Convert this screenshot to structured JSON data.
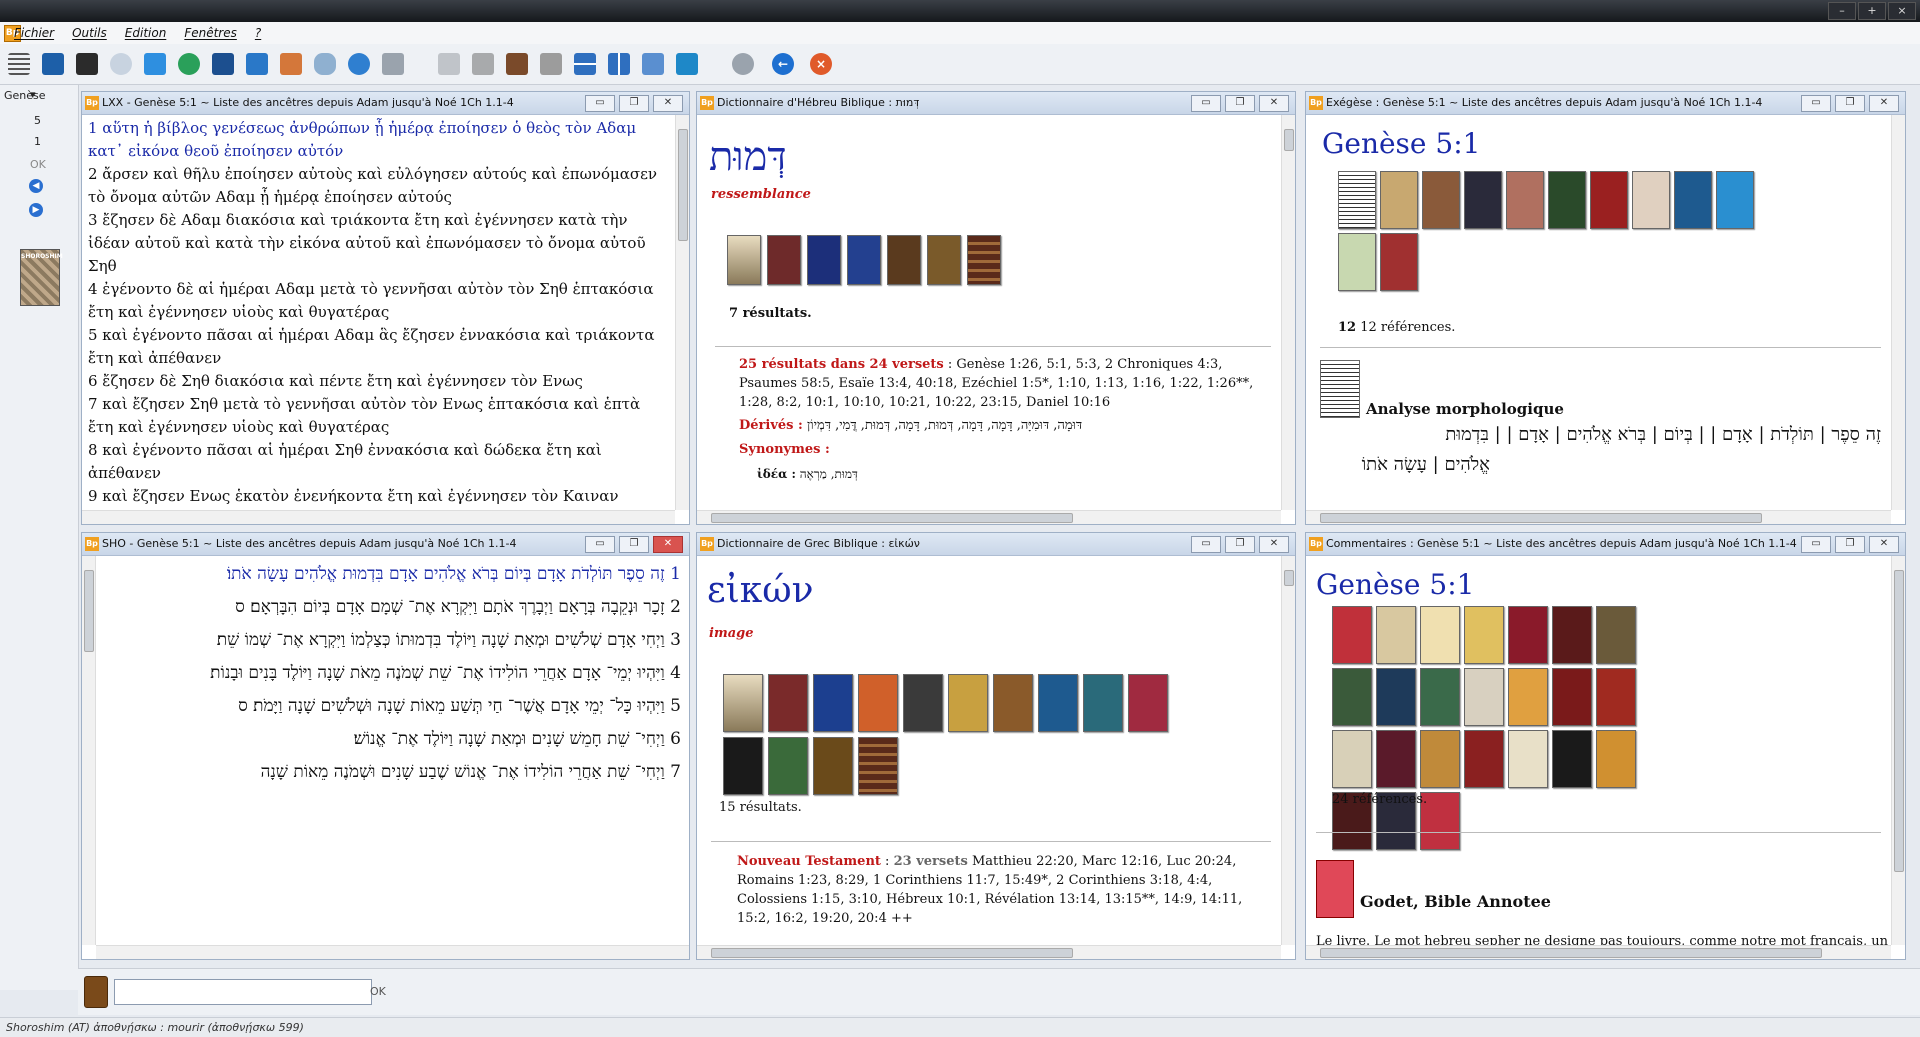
{
  "menu": {
    "fichier": "Fichier",
    "outils": "Outils",
    "edition": "Edition",
    "fenetres": "Fenêtres",
    "help": "?"
  },
  "left": {
    "book": "Genèse",
    "chapter": "5",
    "verse": "1",
    "ok": "OK",
    "module_label": "SHOROSHIM"
  },
  "lxx": {
    "title": "LXX - Genèse 5:1 ~ Liste des ancêtres depuis Adam jusqu'à Noé 1Ch 1.1-4",
    "verses": [
      "1 αὕτη ἡ βίβλος γενέσεως ἀνθρώπων ᾗ ἡμέρᾳ ἐποίησεν ὁ θεὸς τὸν Αδαμ κατ᾽ εἰκόνα θεοῦ ἐποίησεν αὐτόν",
      "2 ἄρσεν καὶ θῆλυ ἐποίησεν αὐτοὺς καὶ εὐλόγησεν αὐτούς καὶ ἐπωνόμασεν τὸ ὄνομα αὐτῶν Αδαμ ᾗ ἡμέρᾳ ἐποίησεν αὐτούς",
      "3 ἔζησεν δὲ Αδαμ διακόσια καὶ τριάκοντα ἔτη καὶ ἐγέννησεν κατὰ τὴν ἰδέαν αὐτοῦ καὶ κατὰ τὴν εἰκόνα αὐτοῦ καὶ ἐπωνόμασεν τὸ ὄνομα αὐτοῦ Σηθ",
      "4 ἐγένοντο δὲ αἱ ἡμέραι Αδαμ μετὰ τὸ γεννῆσαι αὐτὸν τὸν Σηθ ἑπτακόσια ἔτη καὶ ἐγέννησεν υἱοὺς καὶ θυγατέρας",
      "5 καὶ ἐγένοντο πᾶσαι αἱ ἡμέραι Αδαμ ἃς ἔζησεν ἐννακόσια καὶ τριάκοντα ἔτη καὶ ἀπέθανεν",
      "6 ἔζησεν δὲ Σηθ διακόσια καὶ πέντε ἔτη καὶ ἐγέννησεν τὸν Ενως",
      "7 καὶ ἔζησεν Σηθ μετὰ τὸ γεννῆσαι αὐτὸν τὸν Ενως ἑπτακόσια καὶ ἑπτὰ ἔτη καὶ ἐγέννησεν υἱοὺς καὶ θυγατέρας",
      "8 καὶ ἐγένοντο πᾶσαι αἱ ἡμέραι Σηθ ἐννακόσια καὶ δώδεκα ἔτη καὶ ἀπέθανεν",
      "9 καὶ ἔζησεν Ενως ἑκατὸν ἐνενήκοντα ἔτη καὶ ἐγέννησεν τὸν Καιναν"
    ]
  },
  "sho": {
    "title": "SHO - Genèse 5:1 ~ Liste des ancêtres depuis Adam jusqu'à Noé 1Ch 1.1-4",
    "verses": [
      "1 זֶה סֵפֶר תּוֹלְדֹת אָדָם בְּיוֹם בְּרֹא אֱלֹהִים אָדָם בִּדְמוּת אֱלֹהִים עָשָׂה אֹתוֹ׃",
      "2 זָכָר וּנְקֵבָה בְּרָאָם וַיְבָרֶךְ אֹתָם וַיִּקְרָא אֶת־ שְׁמָם אָדָם בְּיוֹם הִבָּרְאָם׃ ס",
      "3 וַיְחִי אָדָם שְׁלֹשִׁים וּמְאַת שָׁנָה וַיּוֹלֶד בִּדְמוּתוֹ כְּצַלְמוֹ וַיִּקְרָא אֶת־ שְׁמוֹ שֵׁת׃",
      "4 וַיִּהְיוּ יְמֵי־ אָדָם אַחֲרֵי הוֹלִידוֹ אֶת־ שֵׁת שְׁמֹנֶה מֵאֹת שָׁנָה וַיּוֹלֶד בָּנִים וּבָנוֹת׃",
      "5 וַיִּהְיוּ כָּל־ יְמֵי אָדָם אֲשֶׁר־ חַי תְּשַׁע מֵאוֹת שָׁנָה וּשְׁלֹשִׁים שָׁנָה וַיָּמֹת׃ ס",
      "6 וַיְחִי־ שֵׁת חָמֵשׁ שָׁנִים וּמְאַת שָׁנָה וַיּוֹלֶד אֶת־ אֱנוֹשׁ׃",
      "7 וַיְחִי־ שֵׁת אַחֲרֵי הוֹלִידוֹ אֶת־ אֱנוֹשׁ שֶׁבַע שָׁנִים וּשְׁמֹנֶה מֵאוֹת שָׁנָה"
    ]
  },
  "heb_dict": {
    "title": "Dictionnaire d'Hébreu Biblique : דְּמוּת",
    "headword": "דְּמוּת",
    "gloss": "ressemblance",
    "results": "7 résultats.",
    "summary_red": "25 résultats dans 24 versets",
    "summary_rest": " : Genèse 1:26, 5:1, 5:3, 2 Chroniques 4:3, Psaumes 58:5, Esaïe 13:4, 40:18, Ezéchiel 1:5*, 1:10, 1:13, 1:16, 1:22, 1:26**, 1:28, 8:2, 10:1, 10:10, 10:21, 10:22, 23:15, Daniel 10:16",
    "derives_label": "Dérivés :",
    "derives": "דּוּמָה, דּוּמִיָּה, דָּמָה, דָּמָה, דְּמוּת, דָּמָה, דְּמוּת, דֳּמִי, דִּמְיוֹן",
    "synonymes_label": "Synonymes :",
    "idea_label": "ἰδέα :",
    "idea_value": "דְּמוּת, מַרְאֶה"
  },
  "grk_dict": {
    "title": "Dictionnaire de Grec Biblique : εἰκών",
    "headword": "εἰκών",
    "gloss": "image",
    "results": "15 résultats.",
    "nt_label": "Nouveau Testament",
    "nt_count": "23 versets",
    "nt_refs": "Matthieu 22:20, Marc 12:16, Luc 20:24, Romains 1:23, 8:29, 1 Corinthiens 11:7, 15:49*, 2 Corinthiens 3:18, 4:4, Colossiens 1:15, 3:10, Hébreux 10:1, Révélation 13:14, 13:15**, 14:9, 14:11, 15:2, 16:2, 19:20, 20:4 ++"
  },
  "exegese": {
    "title": "Exégèse : Genèse 5:1 ~ Liste des ancêtres depuis Adam jusqu'à Noé 1Ch 1.1-4",
    "heading": "Genèse 5:1",
    "refs": "12 références.",
    "morph": "Analyse morphologique",
    "morph_line1": "זֶה סֵפֶר | תּוֹלְדֹת | אָדָם | | בְּיוֹם | בְּרֹא אֱלֹהִים | אָדָם | | בִּדְמוּת",
    "morph_line2": "אֱלֹהִים | עָשָׂה אֹתוֹ"
  },
  "comment": {
    "title": "Commentaires : Genèse 5:1 ~ Liste des ancêtres depuis Adam jusqu'à Noé 1Ch 1.1-4",
    "heading": "Genèse 5:1",
    "refs": "24 références.",
    "book_title": "Godet, Bible Annotee",
    "text": "Le livre. Le mot hebreu sepher ne designe pas toujours, comme notre mot francais, un"
  },
  "bottom": {
    "ok": "OK"
  },
  "status": "Shoroshim (AT)   ἀποθνῄσκω : mourir  (ἀποθνῄσκω 599)"
}
